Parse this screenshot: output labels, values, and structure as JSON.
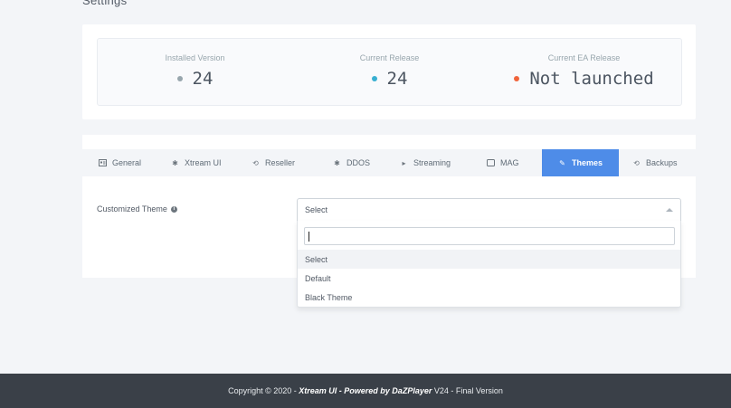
{
  "page": {
    "title": "Settings"
  },
  "stats": [
    {
      "label": "Installed Version",
      "value": "24",
      "dot_color": "#98a6ad"
    },
    {
      "label": "Current Release",
      "value": "24",
      "dot_color": "#39afd1"
    },
    {
      "label": "Current EA Release",
      "value": "Not launched",
      "dot_color": "#f0643b"
    }
  ],
  "tabs": [
    {
      "label": "General",
      "icon": "id-card-icon"
    },
    {
      "label": "Xtream UI",
      "icon": "gear-icon"
    },
    {
      "label": "Reseller",
      "icon": "arrow-loop-icon"
    },
    {
      "label": "DDOS",
      "icon": "gear-icon"
    },
    {
      "label": "Streaming",
      "icon": "play-icon"
    },
    {
      "label": "MAG",
      "icon": "tv-icon"
    },
    {
      "label": "Themes",
      "icon": "brush-icon",
      "active": true
    },
    {
      "label": "Backups",
      "icon": "history-icon"
    }
  ],
  "theme_field": {
    "label": "Customized Theme",
    "selected": "Select",
    "search_value": "",
    "options": [
      "Select",
      "Default",
      "Black Theme"
    ],
    "highlighted": "Select"
  },
  "footer": {
    "prefix": "Copyright © 2020 - ",
    "brand": "Xtream UI - Powered by DaZPlayer",
    "suffix": " V24 - Final Version"
  },
  "colors": {
    "accent": "#4e8ce8",
    "footer_bg": "#3a4048",
    "page_bg": "#f3f5f8"
  }
}
